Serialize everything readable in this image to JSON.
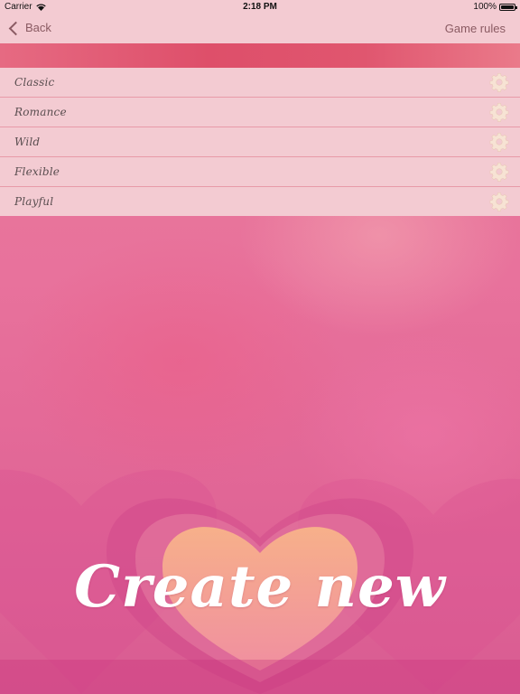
{
  "status_bar": {
    "carrier": "Carrier",
    "time": "2:18 PM",
    "battery": "100%"
  },
  "nav": {
    "back_label": "Back",
    "rules_label": "Game rules"
  },
  "modes": [
    {
      "label": "Classic"
    },
    {
      "label": "Romance"
    },
    {
      "label": "Wild"
    },
    {
      "label": "Flexible"
    },
    {
      "label": "Playful"
    }
  ],
  "cta": {
    "label": "Create new"
  },
  "colors": {
    "nav_background": "#f3cbd2",
    "band": "#de4f6a",
    "heart": "#f6a98a"
  },
  "icons": {
    "back": "chevron-left-icon",
    "settings": "gear-icon",
    "wifi": "wifi-icon",
    "battery": "battery-icon"
  }
}
